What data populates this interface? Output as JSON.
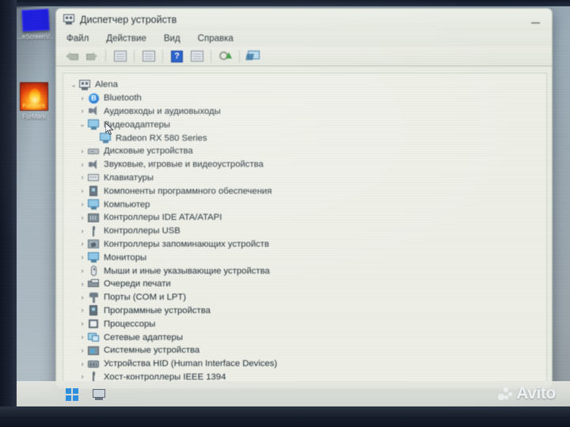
{
  "desktop": {
    "icons": [
      {
        "label": "...eScreenV...",
        "icon": "blue-document-icon"
      },
      {
        "label": "FurMark",
        "icon": "furmark-flame-icon",
        "badge": "FurMark"
      }
    ]
  },
  "taskbar": {
    "start_label": "Windows Start",
    "items": [
      {
        "label": "Device Manager",
        "icon": "device-manager-icon"
      }
    ]
  },
  "watermark": {
    "text": "Avito"
  },
  "window": {
    "title": "Диспетчер устройств",
    "minimize_label": "Свернуть",
    "menu": [
      {
        "label": "Файл"
      },
      {
        "label": "Действие"
      },
      {
        "label": "Вид"
      },
      {
        "label": "Справка"
      }
    ],
    "toolbar": [
      {
        "name": "back-arrow-icon",
        "tip": "Назад"
      },
      {
        "name": "forward-arrow-icon",
        "tip": "Вперед"
      },
      {
        "name": "properties-icon",
        "tip": "Свойства"
      },
      {
        "name": "view-icon",
        "tip": "Вид"
      },
      {
        "name": "help-icon",
        "tip": "Справка",
        "glyph": "?"
      },
      {
        "name": "update-driver-icon",
        "tip": "Обновить драйвер"
      },
      {
        "name": "scan-changes-icon",
        "tip": "Обновить конфигурацию оборудования"
      },
      {
        "name": "show-hidden-devices-icon",
        "tip": "Показать скрытые устройства"
      }
    ],
    "tree": {
      "root": {
        "label": "Alena",
        "expanded": true,
        "icon": "computer-icon"
      },
      "nodes": [
        {
          "label": "Bluetooth",
          "icon": "bluetooth-icon",
          "expanded": false
        },
        {
          "label": "Аудиовходы и аудиовыходы",
          "icon": "audio-icon",
          "expanded": false
        },
        {
          "label": "Видеоадаптеры",
          "icon": "display-adapter-icon",
          "expanded": true,
          "children": [
            {
              "label": "Radeon RX 580 Series",
              "icon": "display-adapter-icon"
            }
          ]
        },
        {
          "label": "Дисковые устройства",
          "icon": "disk-drive-icon",
          "expanded": false
        },
        {
          "label": "Звуковые, игровые и видеоустройства",
          "icon": "audio-icon",
          "expanded": false
        },
        {
          "label": "Клавиатуры",
          "icon": "keyboard-icon",
          "expanded": false
        },
        {
          "label": "Компоненты программного обеспечения",
          "icon": "software-component-icon",
          "expanded": false
        },
        {
          "label": "Компьютер",
          "icon": "computer-monitor-icon",
          "expanded": false
        },
        {
          "label": "Контроллеры IDE ATA/ATAPI",
          "icon": "ide-controller-icon",
          "expanded": false
        },
        {
          "label": "Контроллеры USB",
          "icon": "usb-icon",
          "expanded": false
        },
        {
          "label": "Контроллеры запоминающих устройств",
          "icon": "storage-controller-icon",
          "expanded": false
        },
        {
          "label": "Мониторы",
          "icon": "monitor-icon",
          "expanded": false
        },
        {
          "label": "Мыши и иные указывающие устройства",
          "icon": "mouse-icon",
          "expanded": false
        },
        {
          "label": "Очереди печати",
          "icon": "printer-icon",
          "expanded": false
        },
        {
          "label": "Порты (COM и LPT)",
          "icon": "port-icon",
          "expanded": false
        },
        {
          "label": "Программные устройства",
          "icon": "software-device-icon",
          "expanded": false
        },
        {
          "label": "Процессоры",
          "icon": "processor-icon",
          "expanded": false
        },
        {
          "label": "Сетевые адаптеры",
          "icon": "network-adapter-icon",
          "expanded": false
        },
        {
          "label": "Системные устройства",
          "icon": "system-device-icon",
          "expanded": false
        },
        {
          "label": "Устройства HID (Human Interface Devices)",
          "icon": "hid-icon",
          "expanded": false
        },
        {
          "label": "Хост-контроллеры IEEE 1394",
          "icon": "usb-icon",
          "expanded": false
        }
      ]
    }
  },
  "glyphs": {
    "chevron_collapsed": "›",
    "chevron_expanded": "⌄"
  }
}
